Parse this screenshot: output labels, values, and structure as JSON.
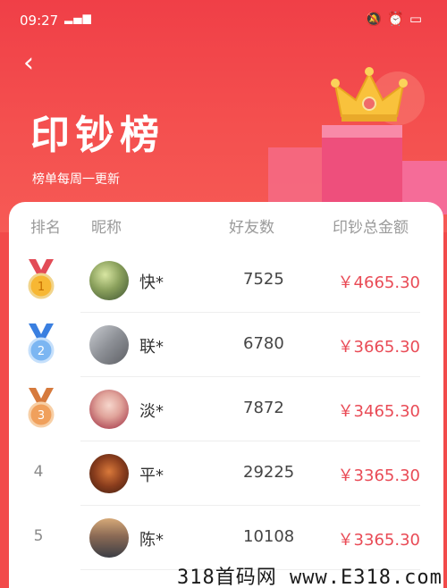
{
  "status_bar": {
    "time": "09:27",
    "network": "4G",
    "icons": [
      "mute-icon",
      "alarm-icon",
      "battery-icon"
    ]
  },
  "header": {
    "back_icon": "back-arrow-icon",
    "title": "印钞榜",
    "subtitle": "榜单每周一更新",
    "colors": {
      "top": "#f03f47",
      "bottom": "#f65a55"
    }
  },
  "table": {
    "headers": {
      "rank": "排名",
      "nickname": "昵称",
      "friends": "好友数",
      "amount": "印钞总金额"
    },
    "rows": [
      {
        "rank": "1",
        "medal": "gold-medal-icon",
        "nickname": "快*",
        "friends": "7525",
        "amount": "￥4665.30"
      },
      {
        "rank": "2",
        "medal": "silver-medal-icon",
        "nickname": "联*",
        "friends": "6780",
        "amount": "￥3665.30"
      },
      {
        "rank": "3",
        "medal": "bronze-medal-icon",
        "nickname": "淡*",
        "friends": "7872",
        "amount": "￥3465.30"
      },
      {
        "rank": "4",
        "medal": "",
        "nickname": "平*",
        "friends": "29225",
        "amount": "￥3365.30"
      },
      {
        "rank": "5",
        "medal": "",
        "nickname": "陈*",
        "friends": "10108",
        "amount": "￥3365.30"
      }
    ],
    "amount_color": "#e94b56"
  },
  "watermark": "318首码网 www.E318.com"
}
